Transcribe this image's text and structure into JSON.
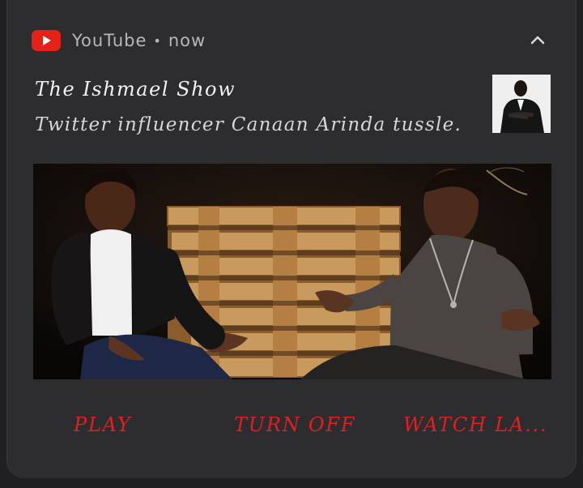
{
  "notification": {
    "app_name": "YouTube",
    "separator": "•",
    "time": "now",
    "title": "The Ishmael Show",
    "text": "Twitter influencer Canaan Arinda tussle."
  },
  "actions": [
    {
      "label": "PLAY"
    },
    {
      "label": "TURN OFF"
    },
    {
      "label": "WATCH LA..."
    }
  ],
  "colors": {
    "background": "#202022",
    "card": "#2d2d2f",
    "accent_red": "#e02020",
    "youtube_red": "#e62117"
  },
  "icons": {
    "app": "youtube-logo-icon",
    "collapse": "chevron-up-icon"
  }
}
